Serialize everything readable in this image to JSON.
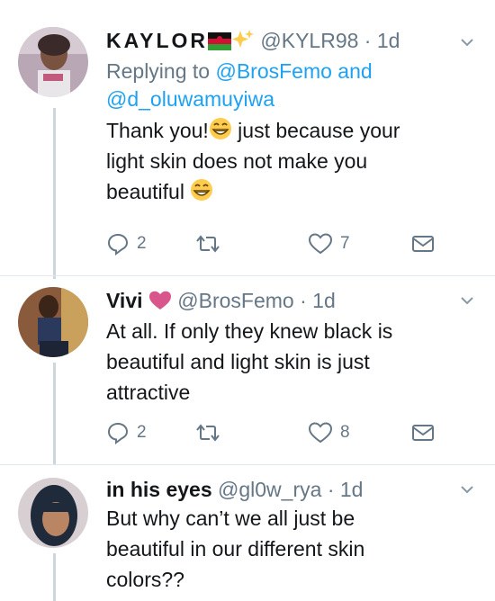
{
  "tweets": [
    {
      "display_name": "KAYLOR",
      "handle": "@KYLR98",
      "separator": "·",
      "time": "1d",
      "replying_prefix": "Replying to",
      "replying_to_1": "@BrosFemo",
      "replying_and": "and",
      "replying_to_2": "@d_oluwamuyiwa",
      "line1": "Thank you!",
      "line1_rest": " just because your",
      "line2": "light skin does not make you",
      "line3": "beautiful",
      "replies": "2",
      "likes": "7",
      "icons": [
        "malawi-flag-icon",
        "sparkles-icon",
        "grinning-emoji-icon"
      ]
    },
    {
      "display_name": "Vivi",
      "handle": "@BrosFemo",
      "separator": "·",
      "time": "1d",
      "line1": "At all. If only they knew black is",
      "line2": "beautiful and light skin is just",
      "line3": "attractive",
      "replies": "2",
      "likes": "8",
      "icons": [
        "pink-heart-icon"
      ]
    },
    {
      "display_name": "in his eyes",
      "handle": "@gl0w_rya",
      "separator": "·",
      "time": "1d",
      "line1": "But why can’t we all just be",
      "line2": "beautiful in our different skin",
      "line3": "colors??"
    }
  ],
  "colors": {
    "link": "#1da1f2",
    "muted": "#657786",
    "text": "#14171a",
    "divider": "#e1e8ed",
    "heart": "#e0245e"
  }
}
